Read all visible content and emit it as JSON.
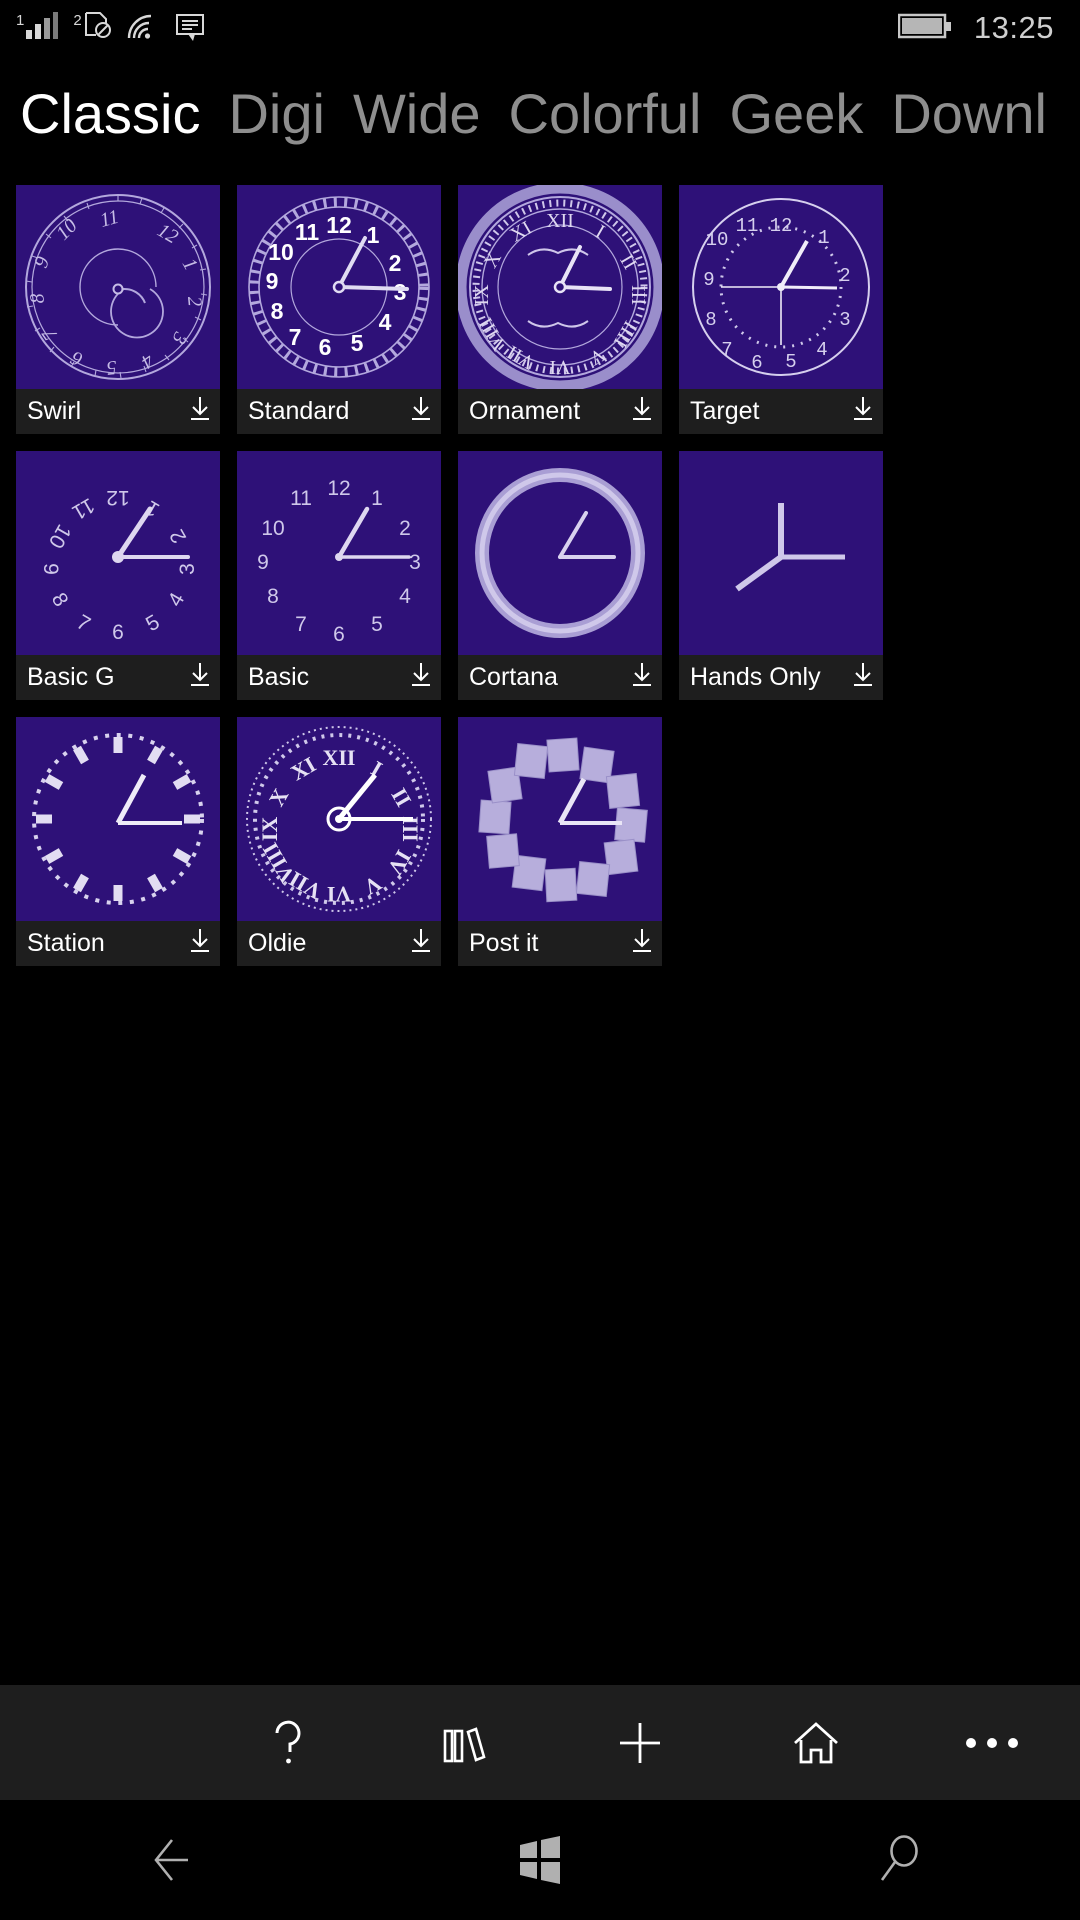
{
  "status_bar": {
    "sim1_label": "1",
    "sim2_label": "2",
    "signal_icon": "signal-bars-icon",
    "sim2_icon": "sim-blocked-icon",
    "wifi_icon": "wifi-icon",
    "message_icon": "message-icon",
    "battery_icon": "battery-icon",
    "time": "13:25"
  },
  "pivot": {
    "items": [
      {
        "label": "Classic",
        "active": true
      },
      {
        "label": "Digi",
        "active": false
      },
      {
        "label": "Wide",
        "active": false
      },
      {
        "label": "Colorful",
        "active": false
      },
      {
        "label": "Geek",
        "active": false
      },
      {
        "label": "Downl",
        "active": false
      }
    ]
  },
  "theme": {
    "tile_background": "#2e1178",
    "tile_bar_background": "#1e1e1e",
    "accent_stroke": "#b3a8dd",
    "page_background": "#000000",
    "active_tab_color": "#ffffff",
    "inactive_tab_color": "#8e8e8e"
  },
  "tiles": [
    {
      "name": "Swirl",
      "face": "swirl",
      "download_icon": "download-icon"
    },
    {
      "name": "Standard",
      "face": "standard",
      "download_icon": "download-icon"
    },
    {
      "name": "Ornament",
      "face": "ornament",
      "download_icon": "download-icon"
    },
    {
      "name": "Target",
      "face": "target",
      "download_icon": "download-icon"
    },
    {
      "name": "Basic G",
      "face": "basicg",
      "download_icon": "download-icon"
    },
    {
      "name": "Basic",
      "face": "basic",
      "download_icon": "download-icon"
    },
    {
      "name": "Cortana",
      "face": "cortana",
      "download_icon": "download-icon"
    },
    {
      "name": "Hands Only",
      "face": "hands",
      "download_icon": "download-icon"
    },
    {
      "name": "Station",
      "face": "station",
      "download_icon": "download-icon"
    },
    {
      "name": "Oldie",
      "face": "oldie",
      "download_icon": "download-icon"
    },
    {
      "name": "Post it",
      "face": "postit",
      "download_icon": "download-icon"
    }
  ],
  "app_bar": {
    "buttons": [
      {
        "name": "help-button",
        "icon": "question-mark-icon"
      },
      {
        "name": "library-button",
        "icon": "books-icon"
      },
      {
        "name": "add-button",
        "icon": "plus-icon"
      },
      {
        "name": "home-button",
        "icon": "home-icon"
      },
      {
        "name": "more-button",
        "icon": "ellipsis-icon"
      }
    ]
  },
  "nav_bar": {
    "buttons": [
      {
        "name": "back-button",
        "icon": "back-arrow-icon"
      },
      {
        "name": "start-button",
        "icon": "windows-logo-icon"
      },
      {
        "name": "search-button",
        "icon": "magnifier-icon"
      }
    ]
  }
}
